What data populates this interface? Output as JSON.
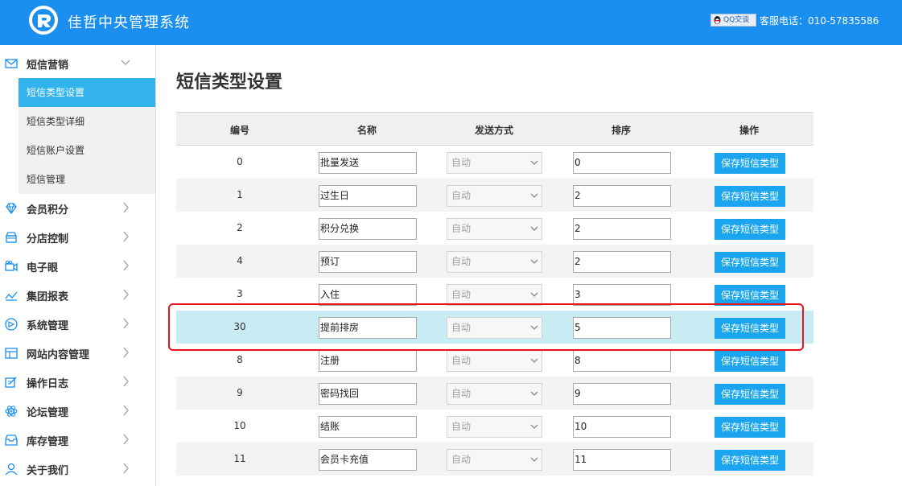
{
  "header": {
    "title": "佳哲中央管理系统",
    "qq_label": "QQ交谈",
    "phone": "客服电话：010-57835586"
  },
  "sidebar": {
    "items": [
      {
        "label": "短信营销",
        "icon": "mail-icon",
        "expanded": true
      },
      {
        "label": "会员积分",
        "icon": "diamond-icon"
      },
      {
        "label": "分店控制",
        "icon": "store-icon"
      },
      {
        "label": "电子眼",
        "icon": "camera-icon"
      },
      {
        "label": "集团报表",
        "icon": "line-chart-icon"
      },
      {
        "label": "系统管理",
        "icon": "settings-circle-icon"
      },
      {
        "label": "网站内容管理",
        "icon": "layout-icon"
      },
      {
        "label": "操作日志",
        "icon": "edit-log-icon"
      },
      {
        "label": "论坛管理",
        "icon": "atom-icon"
      },
      {
        "label": "库存管理",
        "icon": "inbox-icon"
      },
      {
        "label": "关于我们",
        "icon": "user-icon"
      }
    ],
    "subitems": [
      {
        "label": "短信类型设置",
        "active": true
      },
      {
        "label": "短信类型详细"
      },
      {
        "label": "短信账户设置"
      },
      {
        "label": "短信管理"
      }
    ]
  },
  "page": {
    "title": "短信类型设置"
  },
  "table": {
    "headers": [
      "编号",
      "名称",
      "发送方式",
      "排序",
      "操作"
    ],
    "send_mode": "自动",
    "save_label": "保存短信类型",
    "rows": [
      {
        "id": "0",
        "name": "批量发送",
        "sort": "0"
      },
      {
        "id": "1",
        "name": "过生日",
        "sort": "2"
      },
      {
        "id": "2",
        "name": "积分兑换",
        "sort": "2"
      },
      {
        "id": "4",
        "name": "预订",
        "sort": "2"
      },
      {
        "id": "3",
        "name": "入住",
        "sort": "3"
      },
      {
        "id": "30",
        "name": "提前排房",
        "sort": "5",
        "highlighted": true
      },
      {
        "id": "8",
        "name": "注册",
        "sort": "8"
      },
      {
        "id": "9",
        "name": "密码找回",
        "sort": "9"
      },
      {
        "id": "10",
        "name": "结账",
        "sort": "10"
      },
      {
        "id": "11",
        "name": "会员卡充值",
        "sort": "11"
      }
    ]
  },
  "colors": {
    "header_bg": "#1a8fef",
    "active_sub": "#33b3ee",
    "button": "#1aa5ee",
    "highlight_row": "#c9ecf4",
    "annotation": "#e8131a"
  }
}
